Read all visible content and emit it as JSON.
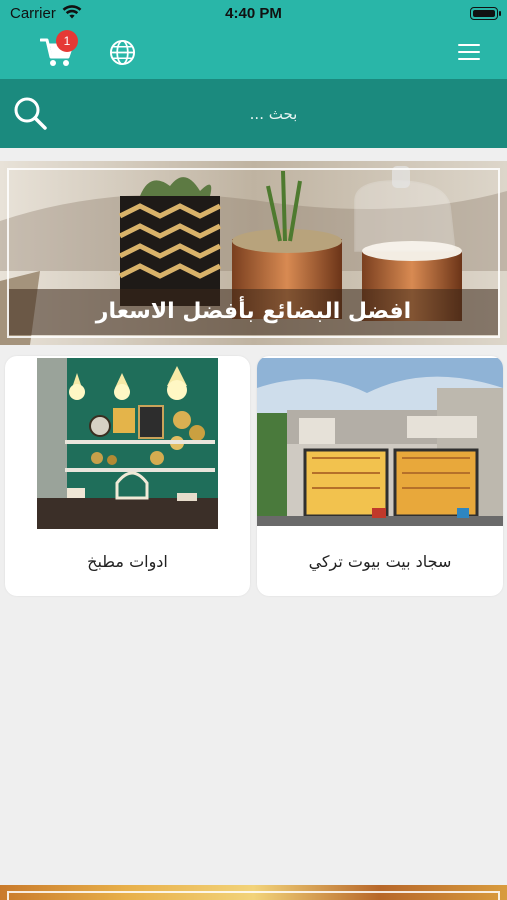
{
  "status_bar": {
    "carrier": "Carrier",
    "time": "4:40 PM"
  },
  "nav": {
    "cart_count": "1",
    "icons": [
      "cart-icon",
      "globe-icon",
      "hamburger-menu-icon"
    ],
    "accent_color": "#29b6a8",
    "badge_color": "#e53935"
  },
  "search": {
    "placeholder": "بحث ...",
    "value": "",
    "bar_color": "#1b8a7e"
  },
  "banner": {
    "caption": "افضل البضائع بأفضل الاسعار"
  },
  "categories": [
    {
      "title": "سجاد بيت بيوت تركي"
    },
    {
      "title": "ادوات مطبخ"
    }
  ]
}
